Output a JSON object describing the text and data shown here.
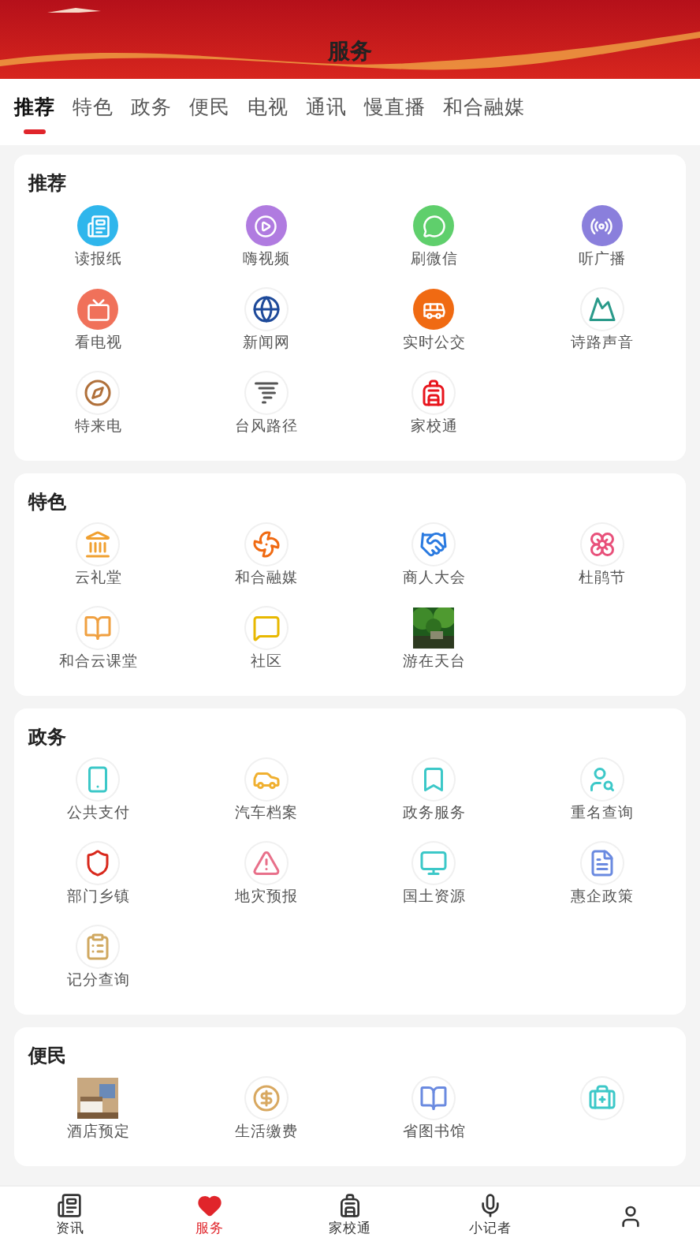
{
  "header": {
    "title": "服务"
  },
  "tabs": [
    {
      "label": "推荐",
      "selected": true
    },
    {
      "label": "特色",
      "selected": false
    },
    {
      "label": "政务",
      "selected": false
    },
    {
      "label": "便民",
      "selected": false
    },
    {
      "label": "电视",
      "selected": false
    },
    {
      "label": "通讯",
      "selected": false
    },
    {
      "label": "慢直播",
      "selected": false
    },
    {
      "label": "和合融媒",
      "selected": false
    }
  ],
  "sections": [
    {
      "title": "推荐",
      "items": [
        {
          "kind": "icon",
          "label": "读报纸"
        },
        {
          "kind": "icon",
          "label": "嗨视频"
        },
        {
          "kind": "icon",
          "label": "刷微信"
        },
        {
          "kind": "icon",
          "label": "听广播"
        },
        {
          "kind": "icon",
          "label": "看电视"
        },
        {
          "kind": "icon",
          "label": "新闻网"
        },
        {
          "kind": "icon",
          "label": "实时公交"
        },
        {
          "kind": "icon",
          "label": "诗路声音"
        },
        {
          "kind": "icon",
          "label": "特来电"
        },
        {
          "kind": "icon",
          "label": "台风路径"
        },
        {
          "kind": "icon",
          "label": "家校通"
        }
      ]
    },
    {
      "title": "特色",
      "items": [
        {
          "kind": "icon",
          "label": "云礼堂"
        },
        {
          "kind": "icon",
          "label": "和合融媒"
        },
        {
          "kind": "icon",
          "label": "商人大会"
        },
        {
          "kind": "icon",
          "label": "杜鹃节"
        },
        {
          "kind": "icon",
          "label": "和合云课堂"
        },
        {
          "kind": "icon",
          "label": "社区"
        },
        {
          "kind": "picture",
          "label": "游在天台"
        }
      ]
    },
    {
      "title": "政务",
      "items": [
        {
          "kind": "icon",
          "label": "公共支付"
        },
        {
          "kind": "icon",
          "label": "汽车档案"
        },
        {
          "kind": "icon",
          "label": "政务服务"
        },
        {
          "kind": "icon",
          "label": "重名查询"
        },
        {
          "kind": "icon",
          "label": "部门乡镇"
        },
        {
          "kind": "icon",
          "label": "地灾预报"
        },
        {
          "kind": "icon",
          "label": "国土资源"
        },
        {
          "kind": "icon",
          "label": "惠企政策"
        },
        {
          "kind": "icon",
          "label": "记分查询"
        }
      ]
    },
    {
      "title": "便民",
      "items": [
        {
          "kind": "picture",
          "label": "酒店预定"
        },
        {
          "kind": "icon",
          "label": "生活缴费"
        },
        {
          "kind": "icon",
          "label": "省图书馆"
        },
        {
          "kind": "icon"
        }
      ]
    }
  ],
  "nav": [
    {
      "label": "资讯",
      "selected": false
    },
    {
      "label": "服务",
      "selected": true
    },
    {
      "label": "家校通",
      "selected": false
    },
    {
      "label": "小记者",
      "selected": false
    },
    {
      "selected": false
    }
  ]
}
